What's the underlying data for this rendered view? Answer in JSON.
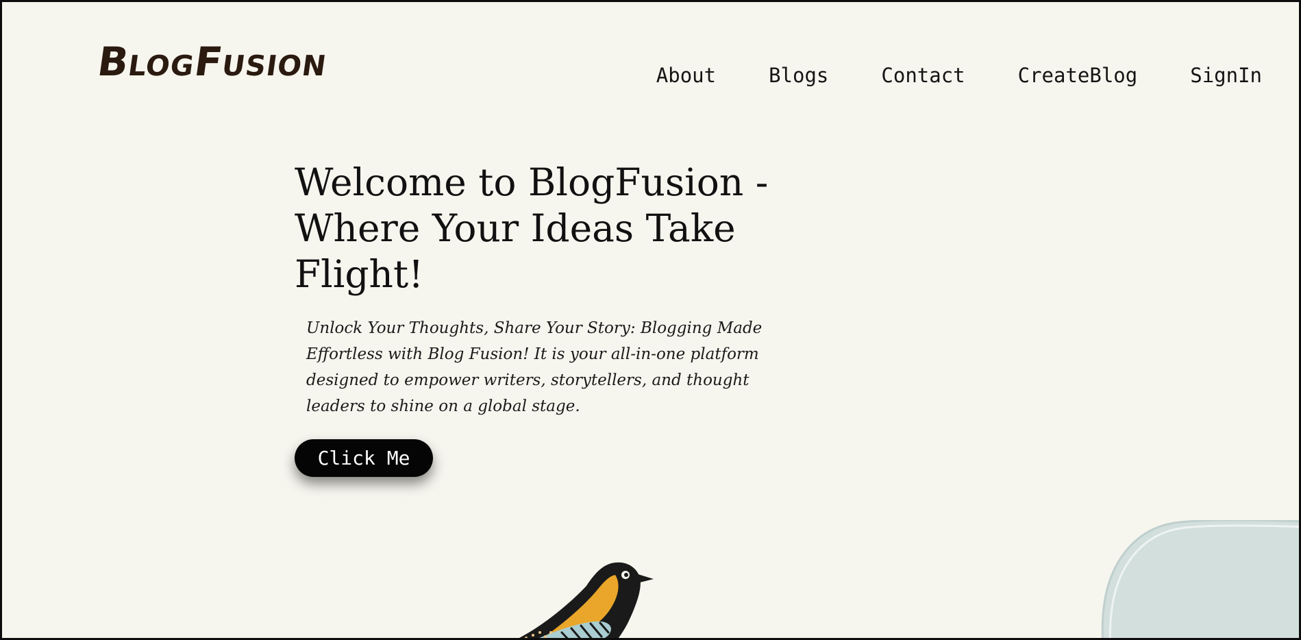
{
  "brand": {
    "logo_text": "BlogFusion"
  },
  "nav": {
    "items": [
      "About",
      "Blogs",
      "Contact",
      "CreateBlog",
      "SignIn"
    ]
  },
  "hero": {
    "title": "Welcome to BlogFusion - Where Your Ideas Take Flight!",
    "subtitle": "Unlock Your Thoughts, Share Your Story: Blogging Made Effortless with Blog Fusion! It is your all-in-one platform designed to empower writers, storytellers, and thought leaders to shine on a global stage.",
    "cta_label": "Click Me"
  },
  "decorations": {
    "bird": "bird-illustration",
    "blob": "cloud-blob-shape"
  },
  "colors": {
    "background": "#f6f5ee",
    "text": "#111111",
    "button_bg": "#050505",
    "button_text": "#ffffff",
    "blob": "#d2dfdd",
    "bird_orange": "#e9a62a",
    "bird_blue": "#a9cdd0"
  }
}
